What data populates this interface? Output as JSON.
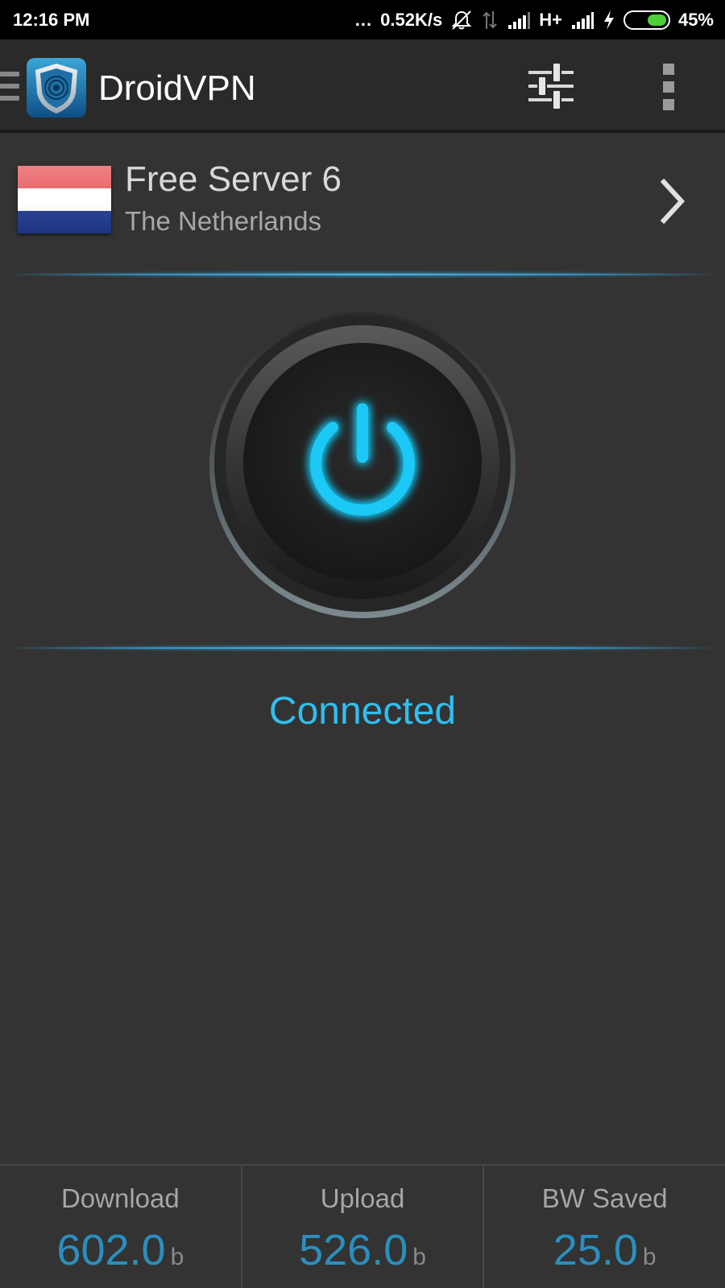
{
  "status_bar": {
    "time": "12:16 PM",
    "dots": "...",
    "net_speed": "0.52K/s",
    "network_type": "H+",
    "battery_percent": "45%",
    "battery_level": 0.45
  },
  "toolbar": {
    "title": "DroidVPN",
    "icons": [
      "drawer-icon",
      "app-logo-icon",
      "settings-sliders-icon",
      "overflow-menu-icon"
    ]
  },
  "server": {
    "name": "Free Server 6",
    "country": "The Netherlands",
    "flag_colors": [
      "#e8585c",
      "#ffffff",
      "#1e3a8f"
    ]
  },
  "connection": {
    "status": "Connected",
    "accent_color": "#2fbff0"
  },
  "stats": [
    {
      "label": "Download",
      "value": "602.0",
      "unit": "b"
    },
    {
      "label": "Upload",
      "value": "526.0",
      "unit": "b"
    },
    {
      "label": "BW Saved",
      "value": "25.0",
      "unit": "b"
    }
  ]
}
